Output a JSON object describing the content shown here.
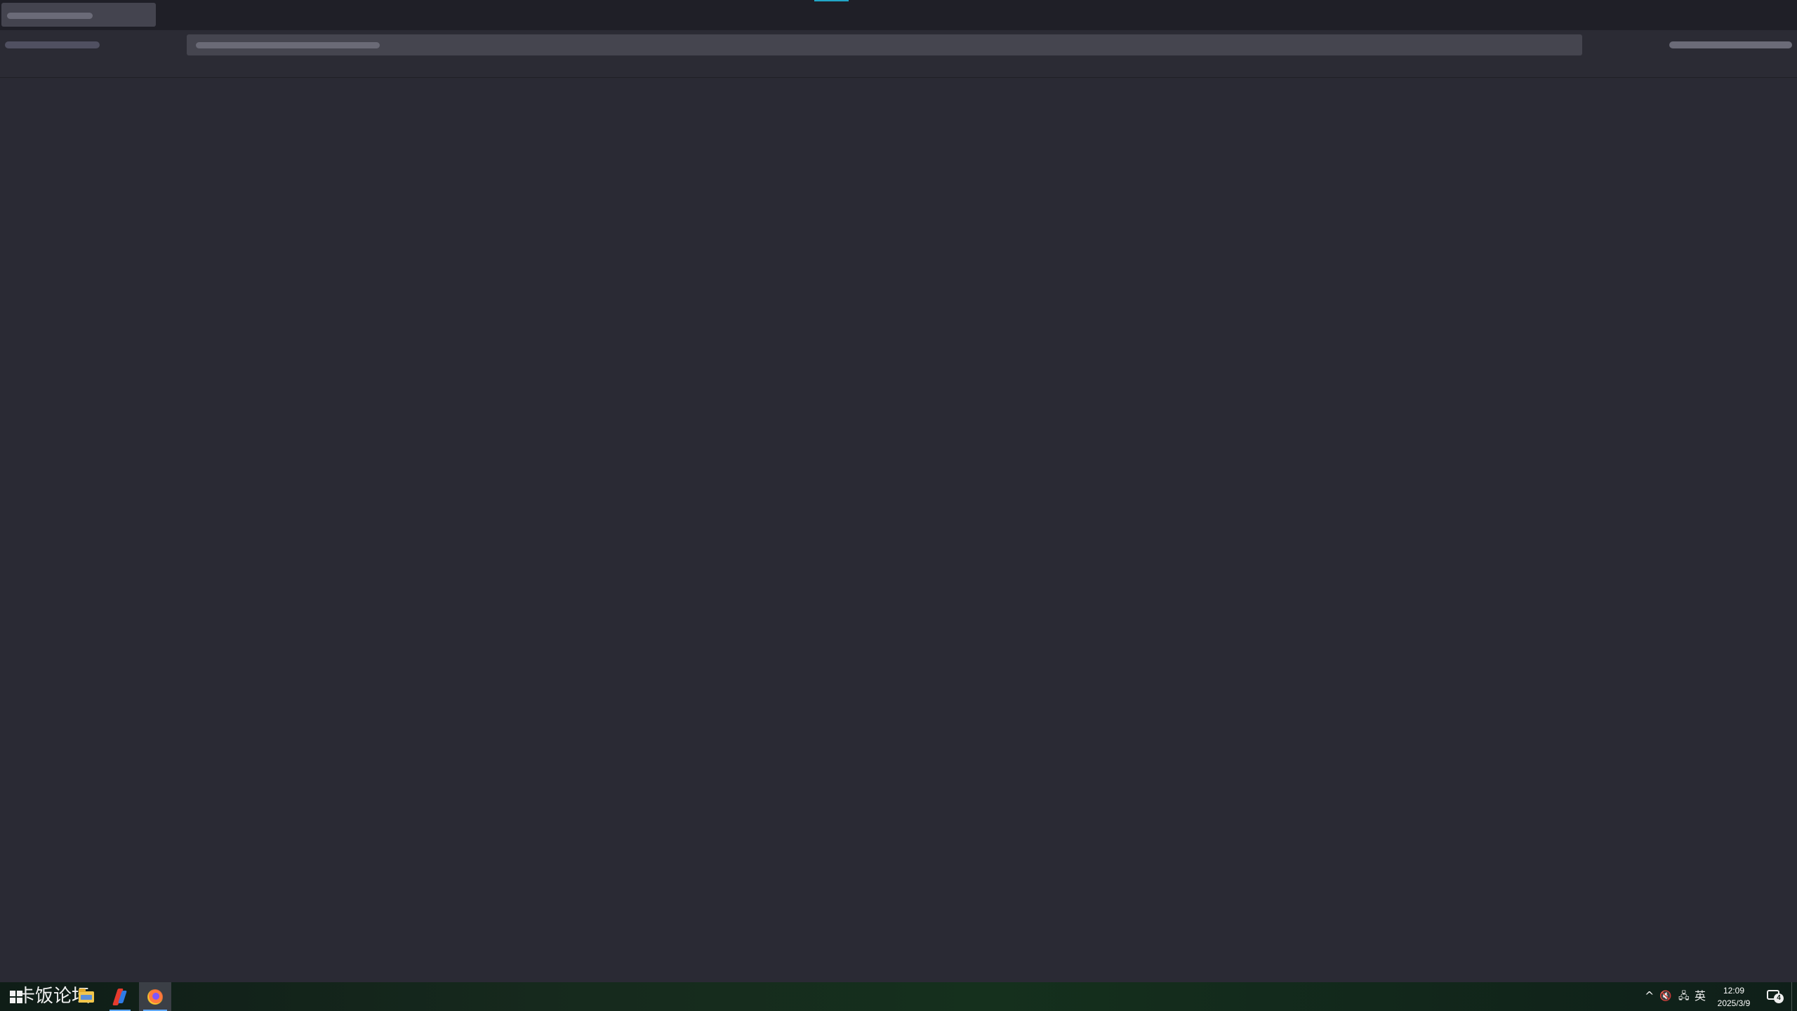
{
  "taskbar": {
    "watermark_text": "卡饭论坛",
    "tray": {
      "chevron": "^",
      "volume_glyph": "🔇",
      "network_glyph": "🖧",
      "ime_label": "英"
    },
    "clock": {
      "time": "12:09",
      "date": "2025/3/9"
    },
    "notifications_count": "4"
  },
  "icons": {
    "start": "windows-start-icon",
    "file_explorer": "folder-icon",
    "app_1": "bolt-icon",
    "app_2": "browser-icon",
    "notifications": "notification-center-icon",
    "volume": "volume-muted-icon",
    "network": "network-icon"
  },
  "colors": {
    "background": "#2a2a34",
    "tabbar": "#1f1f27",
    "tab_active": "#44444f",
    "tab_indicator": "#22a6c8",
    "urlbar": "#45454f",
    "taskbar_active_indicator": "#5fa8ff"
  }
}
